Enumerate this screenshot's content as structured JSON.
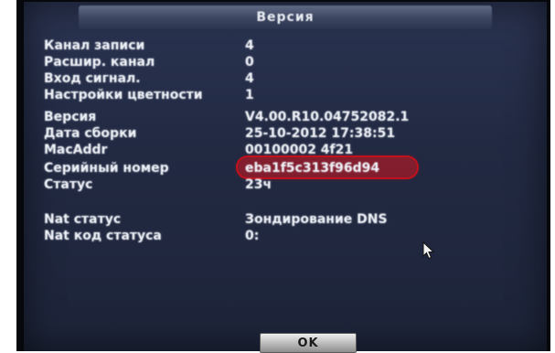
{
  "dialog": {
    "title": "Версия",
    "rows": [
      {
        "label": "Канал записи",
        "value": "4"
      },
      {
        "label": "Расшир. канал",
        "value": "0"
      },
      {
        "label": "Вход сигнал.",
        "value": "4"
      },
      {
        "label": "Настройки цветности",
        "value": "1"
      },
      {
        "label": "Версия",
        "value": "V4.00.R10.04752082.1"
      },
      {
        "label": "Дата сборки",
        "value": "25-10-2012 17:38:51"
      },
      {
        "label": "MacAddr",
        "value": "00100002 4f21"
      },
      {
        "label": "Серийный номер",
        "value": "eba1f5c313f96d94"
      },
      {
        "label": "Статус",
        "value": "23ч"
      },
      {
        "label": "Nat статус",
        "value": "Зондирование DNS"
      },
      {
        "label": "Nat код статуса",
        "value": "0:"
      }
    ],
    "ok_label": "OK"
  },
  "colors": {
    "panel": "#222a43",
    "title_bar": "#3b4560",
    "text": "#eef1f6",
    "highlight": "#c0121c"
  },
  "icons": {
    "cursor": "mouse-pointer-icon"
  }
}
